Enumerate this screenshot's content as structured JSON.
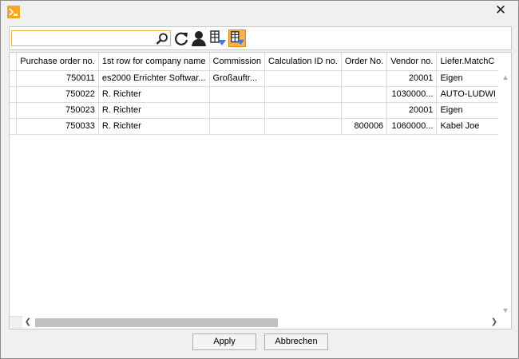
{
  "window": {
    "close_glyph": "✕",
    "icons": {
      "app": "app-icon",
      "close": "close-icon"
    }
  },
  "toolbar": {
    "search": {
      "value": "",
      "placeholder": ""
    },
    "icons": [
      "search-icon",
      "refresh-icon",
      "user-icon",
      "filter-grid-icon",
      "filter-grid-active-icon"
    ],
    "accent": "#f6b24d"
  },
  "grid": {
    "columns": [
      "",
      "Purchase order no.",
      "1st row for company name",
      "Commission",
      "Calculation ID no.",
      "Order No.",
      "Vendor no.",
      "Liefer.MatchC"
    ],
    "rows": [
      [
        "",
        "750011",
        "es2000 Errichter Softwar...",
        "Großauftr...",
        "",
        "",
        "20001",
        "Eigen"
      ],
      [
        "",
        "750022",
        "R. Richter",
        "",
        "",
        "",
        "1030000...",
        "AUTO-LUDWI"
      ],
      [
        "",
        "750023",
        "R. Richter",
        "",
        "",
        "",
        "20001",
        "Eigen"
      ],
      [
        "",
        "750033",
        "R. Richter",
        "",
        "",
        "800006",
        "1060000...",
        "Kabel Joe"
      ]
    ]
  },
  "buttons": {
    "apply": "Apply",
    "cancel": "Abbrechen"
  }
}
